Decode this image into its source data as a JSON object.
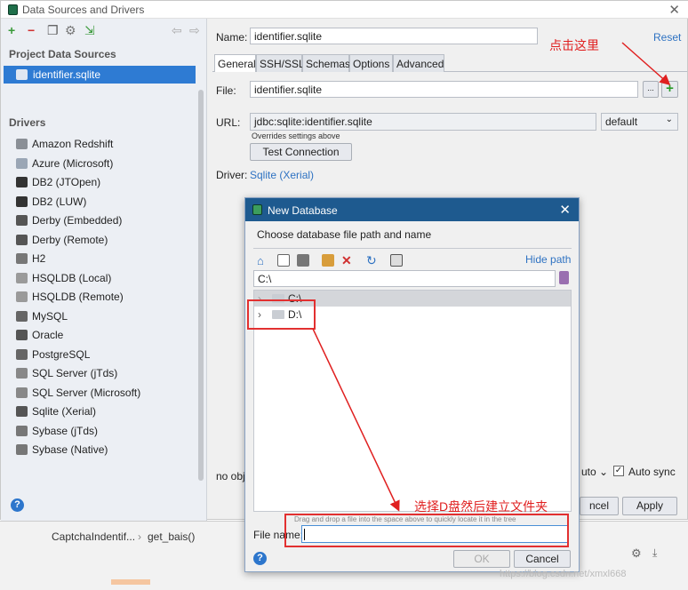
{
  "main_window": {
    "title": "Data Sources and Drivers",
    "project_section": "Project Data Sources",
    "project_item": "identifier.sqlite",
    "drivers_section": "Drivers",
    "drivers": [
      "Amazon Redshift",
      "Azure (Microsoft)",
      "DB2 (JTOpen)",
      "DB2 (LUW)",
      "Derby (Embedded)",
      "Derby (Remote)",
      "H2",
      "HSQLDB (Local)",
      "HSQLDB (Remote)",
      "MySQL",
      "Oracle",
      "PostgreSQL",
      "SQL Server (jTds)",
      "SQL Server (Microsoft)",
      "Sqlite (Xerial)",
      "Sybase (jTds)",
      "Sybase (Native)"
    ],
    "name_label": "Name:",
    "name_value": "identifier.sqlite",
    "reset": "Reset",
    "tabs": [
      "General",
      "SSH/SSL",
      "Schemas",
      "Options",
      "Advanced"
    ],
    "file_label": "File:",
    "file_value": "identifier.sqlite",
    "file_browse": "...",
    "file_add": "+",
    "url_label": "URL:",
    "url_value": "jdbc:sqlite:identifier.sqlite",
    "url_mode": "default",
    "overrides_note": "Overrides settings above",
    "test_connection": "Test Connection",
    "driver_label": "Driver:",
    "driver_value": "Sqlite (Xerial)",
    "no_obj": "no obj",
    "auto": "uto",
    "auto_sync": "Auto sync",
    "cancel": "ncel",
    "apply": "Apply",
    "help": "?"
  },
  "annotations": {
    "click_here": "点击这里",
    "choose_d": "选择D盘然后建立文件夹"
  },
  "ide_behind": {
    "breadcrumb_a": "CaptchaIndentif...",
    "breadcrumb_b": "get_bais()"
  },
  "dialog": {
    "title": "New Database",
    "prompt": "Choose database file path and name",
    "hide_path": "Hide path",
    "path_value": "C:\\",
    "tree": [
      "C:\\",
      "D:\\"
    ],
    "drop_hint": "Drag and drop a file into the space above to quickly locate it in the tree",
    "file_name_label": "File name:",
    "file_name_value": "",
    "ok": "OK",
    "cancel": "Cancel",
    "help": "?"
  },
  "watermark": "https://blog.csdn.net/xmxl668",
  "colors": {
    "accent": "#2e7bd3",
    "title_bar": "#1e5a8f",
    "annotation": "#e02020",
    "link": "#2e72c2"
  }
}
